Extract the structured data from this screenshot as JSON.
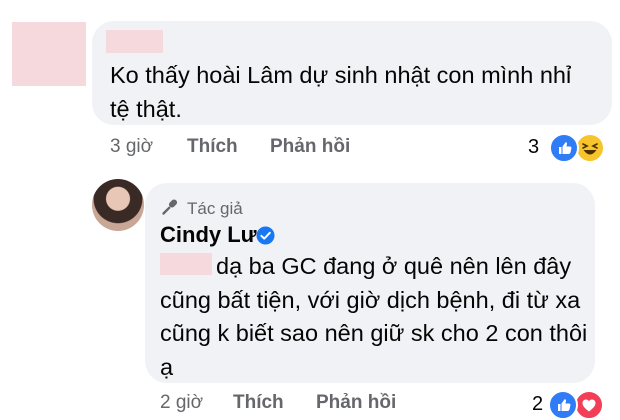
{
  "comment": {
    "text": "Ko thấy hoài Lâm dự sinh nhật con mình nhỉ tệ thật.",
    "time": "3 giờ",
    "like_label": "Thích",
    "reply_label": "Phản hồi",
    "reaction_count": "3",
    "reactions": [
      "like-icon",
      "haha-icon"
    ]
  },
  "reply": {
    "badge": "Tác giả",
    "author": "Cindy Lư",
    "text": "dạ ba GC đang ở quê nên lên đây cũng bất tiện, với giờ dịch bệnh, đi từ xa cũng k biết sao nên giữ sk cho 2 con thôi ạ",
    "time": "2 giờ",
    "like_label": "Thích",
    "reply_label": "Phản hồi",
    "reaction_count": "2",
    "reactions": [
      "like-icon",
      "love-icon"
    ]
  },
  "colors": {
    "bubble": "#f0f2f5",
    "meta_text": "#65676b",
    "like_blue": "#2f7cf6",
    "haha_yellow": "#f7c52b",
    "love_red": "#f33e58",
    "redaction_pink": "#f6d9dc"
  }
}
